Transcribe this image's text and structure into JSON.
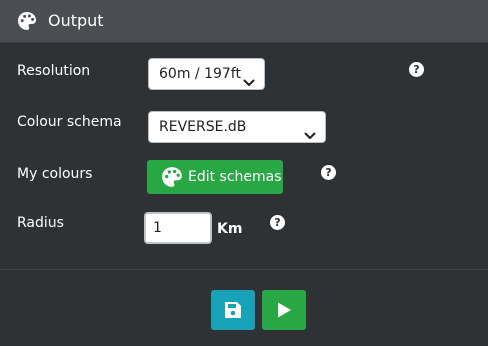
{
  "header": {
    "title": "Output",
    "icon": "palette-icon"
  },
  "form": {
    "resolution": {
      "label": "Resolution",
      "selected": "60m / 197ft",
      "help": "?"
    },
    "colour_schema": {
      "label": "Colour schema",
      "selected": "REVERSE.dB"
    },
    "my_colours": {
      "label": "My colours",
      "button_label": "Edit schemas",
      "button_icon": "palette-icon",
      "help": "?"
    },
    "radius": {
      "label": "Radius",
      "value": "1",
      "unit": "Km",
      "help": "?"
    }
  },
  "actions": {
    "save_icon": "save-icon",
    "run_icon": "play-icon"
  },
  "colors": {
    "background": "#2f3234",
    "header": "#4a4e52",
    "green": "#28a745",
    "teal": "#17a2b8"
  }
}
